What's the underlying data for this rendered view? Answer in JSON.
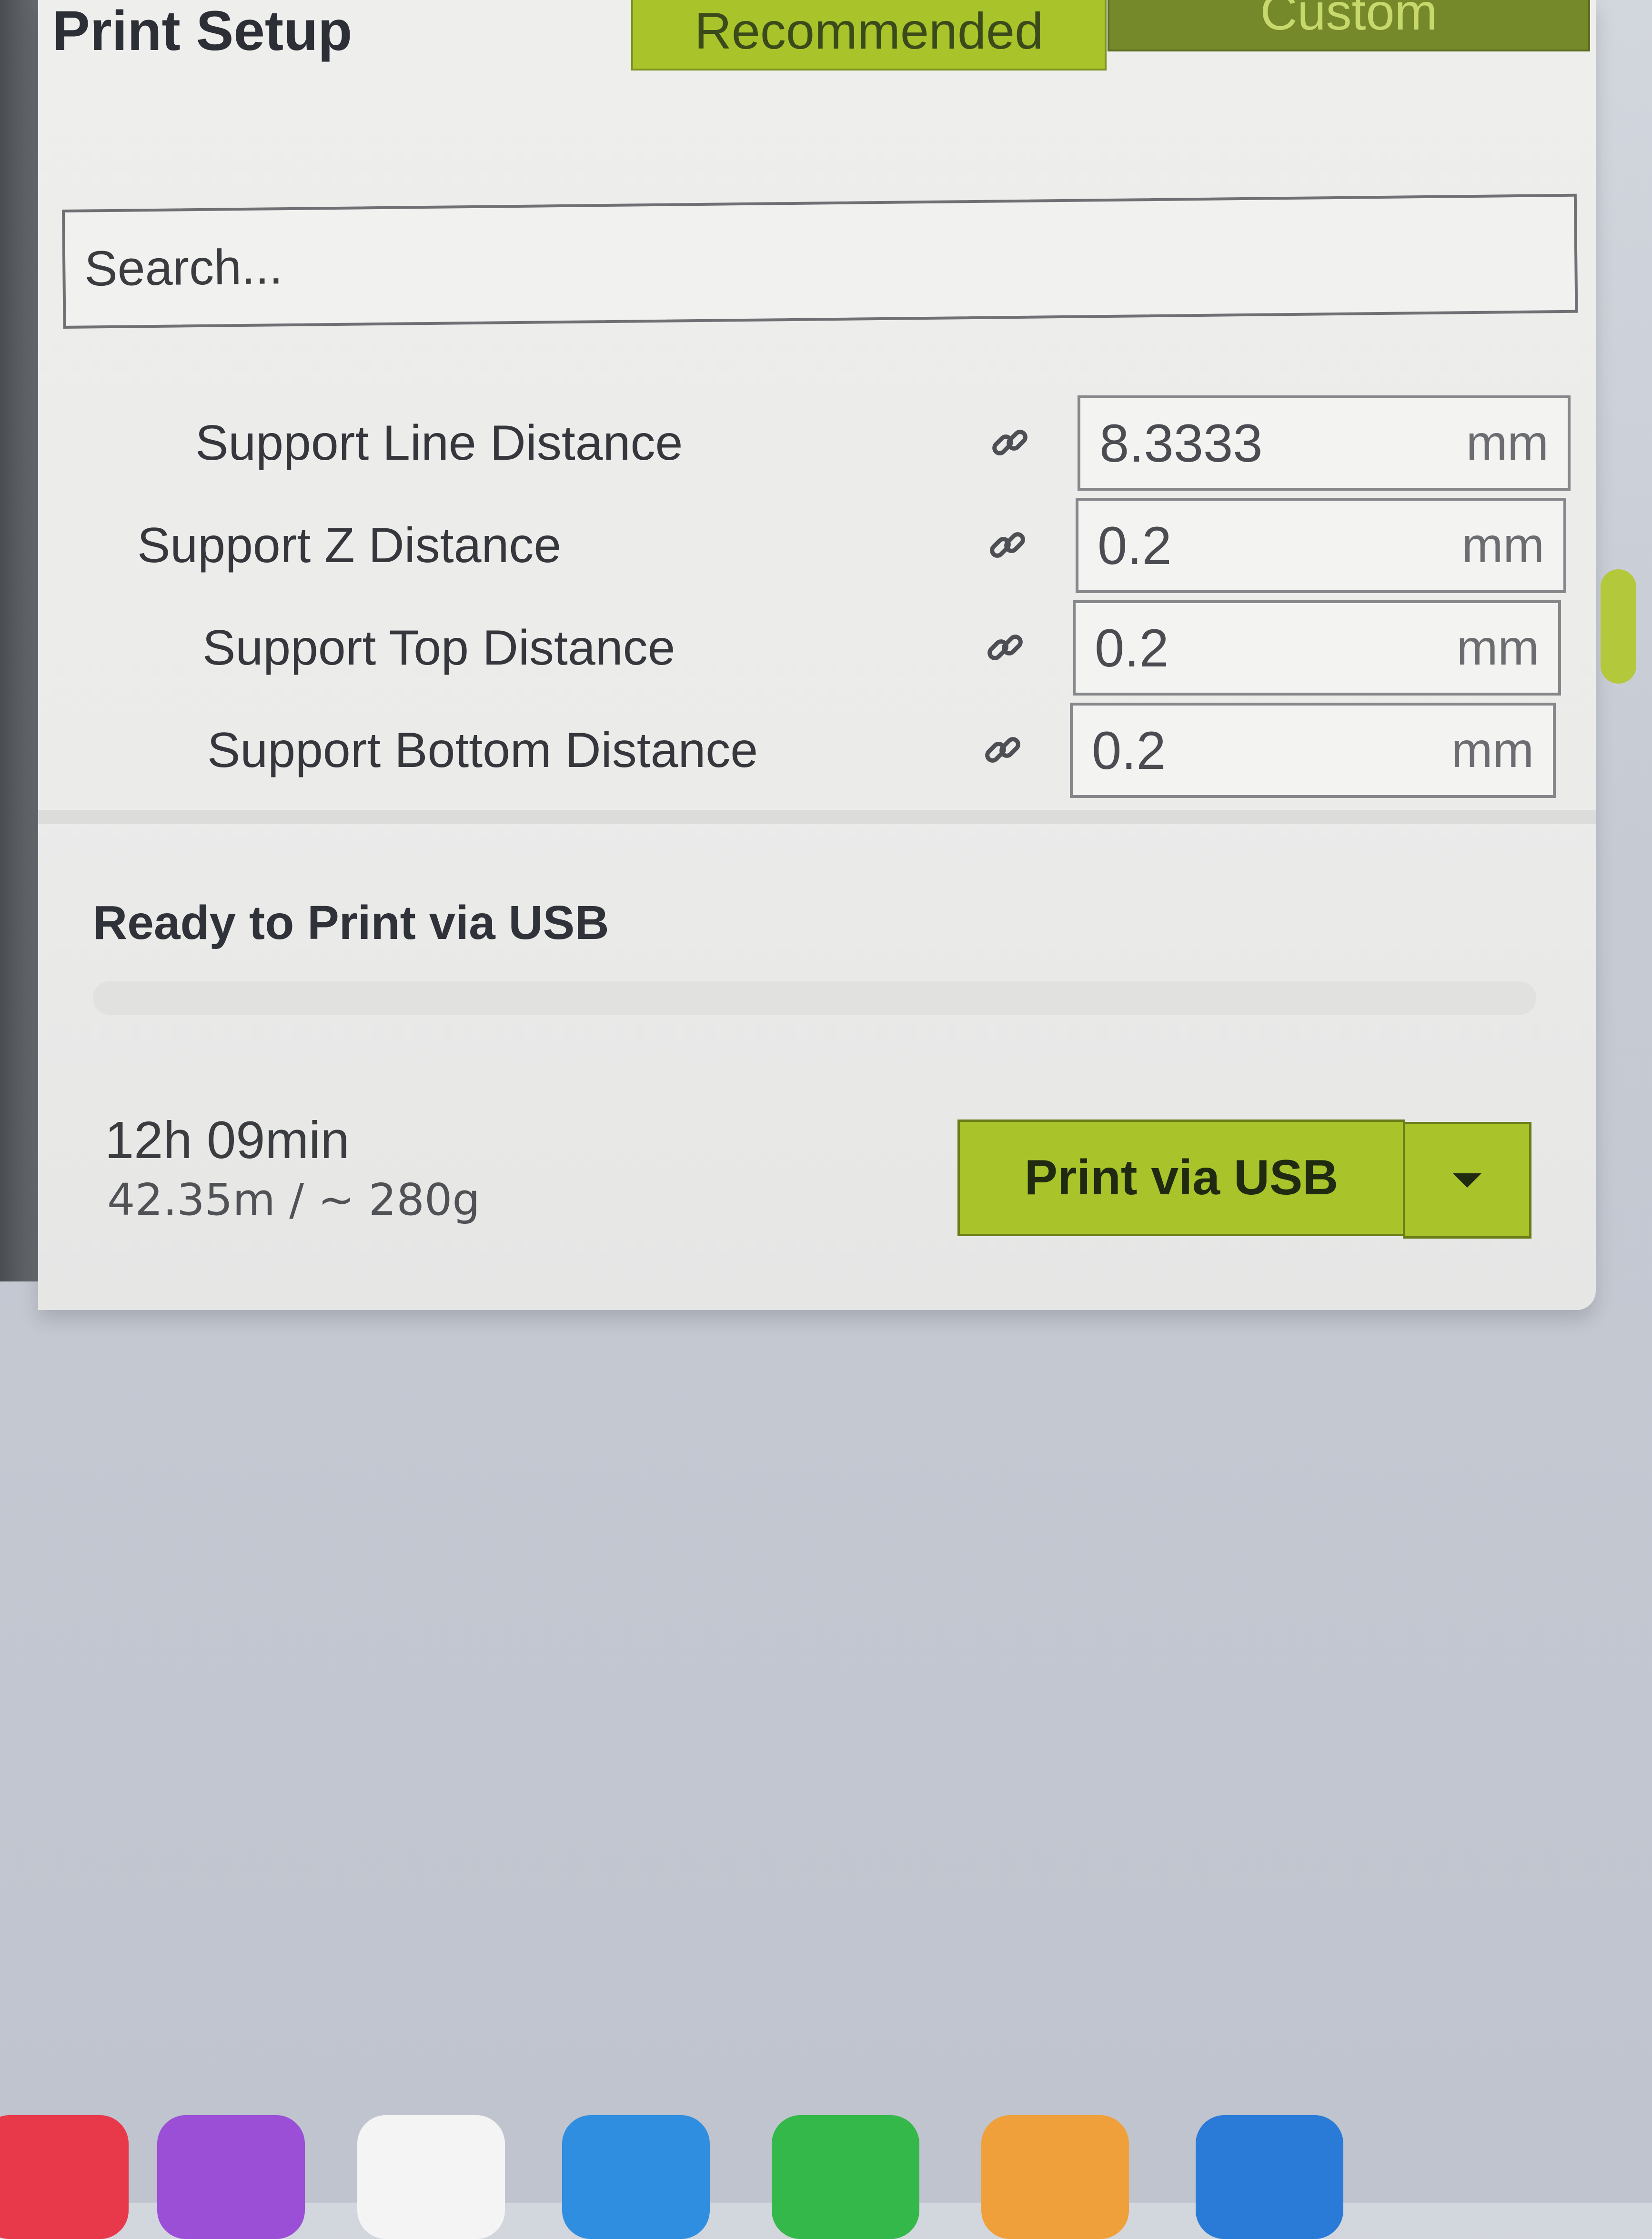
{
  "header": {
    "title": "Print Setup",
    "tabs": [
      {
        "label": "Recommended"
      },
      {
        "label": "Custom"
      }
    ]
  },
  "search": {
    "placeholder": "Search..."
  },
  "settings": [
    {
      "label": "Support Line Distance",
      "value": "8.3333",
      "unit": "mm"
    },
    {
      "label": "Support Z Distance",
      "value": "0.2",
      "unit": "mm"
    },
    {
      "label": "Support Top Distance",
      "value": "0.2",
      "unit": "mm"
    },
    {
      "label": "Support Bottom Distance",
      "value": "0.2",
      "unit": "mm"
    }
  ],
  "status": {
    "text": "Ready to Print via USB"
  },
  "estimate": {
    "time": "12h 09min",
    "material": "42.35m / ~ 280g"
  },
  "print_button": {
    "label": "Print via USB"
  },
  "colors": {
    "accent": "#a9c42b",
    "accent_dark": "#75892a"
  },
  "dock": {
    "apps": [
      "music-icon",
      "podcasts-icon",
      "news-icon",
      "keynote-icon",
      "numbers-icon",
      "pages-icon",
      "app-store-icon"
    ]
  }
}
